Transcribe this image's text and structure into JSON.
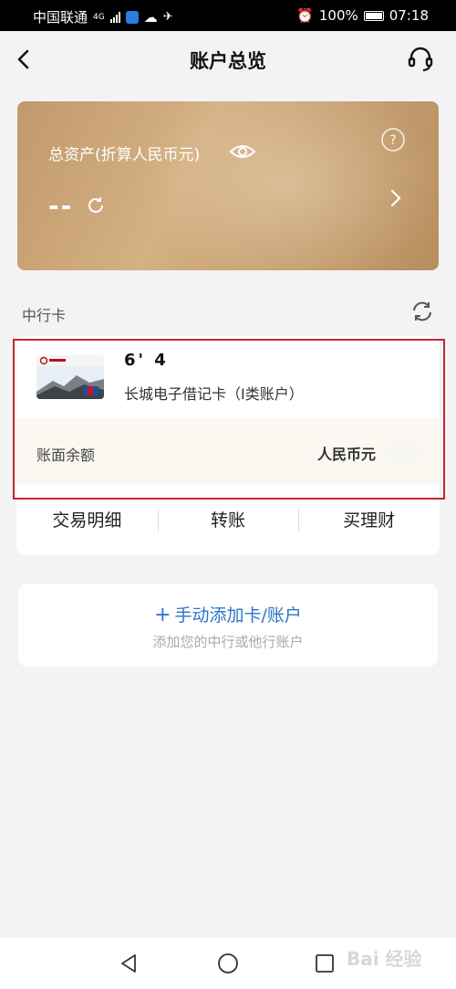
{
  "status_bar": {
    "carrier": "中国联通",
    "network": "4G",
    "battery": "100%",
    "time": "07:18"
  },
  "header": {
    "title": "账户总览",
    "back_icon": "chevron-left-icon",
    "service_icon": "headset-icon"
  },
  "asset_card": {
    "label": "总资产(折算人民币元)",
    "value": "--",
    "colors": {
      "gradient_from": "#c19a6b",
      "gradient_to": "#b78f5f"
    }
  },
  "section": {
    "label": "中行卡"
  },
  "bank_card": {
    "number_masked": "6'            4",
    "name": "长城电子借记卡（I类账户）",
    "balance_label": "账面余额",
    "currency": "人民币元",
    "actions": [
      "交易明细",
      "转账",
      "买理财"
    ]
  },
  "add_card": {
    "title": "手动添加卡/账户",
    "plus": "+",
    "subtitle": "添加您的中行或他行账户",
    "accent": "#2e73c9"
  },
  "watermark": "Bai 经验",
  "highlight_color": "#c4262e"
}
